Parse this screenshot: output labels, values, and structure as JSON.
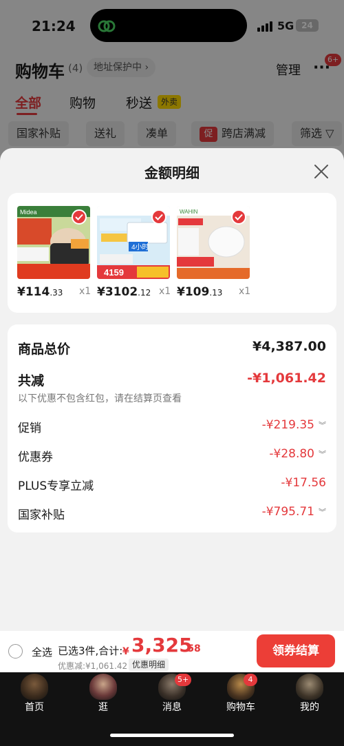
{
  "status_bar": {
    "time": "21:24",
    "network": "5G",
    "battery": "24"
  },
  "cart_header": {
    "title": "购物车",
    "count": "(4)",
    "address": "地址保护中",
    "manage": "管理",
    "more_badge": "6+"
  },
  "tabs": [
    {
      "label": "全部",
      "active": true
    },
    {
      "label": "购物"
    },
    {
      "label": "秒送",
      "tag": "外卖"
    }
  ],
  "filters": [
    "国家补贴",
    "送礼",
    "凑单",
    "跨店满减",
    "筛选"
  ],
  "filter_tag": "促",
  "sheet": {
    "title": "金额明细",
    "products": [
      {
        "price_main": "¥114",
        "price_dec": ".33",
        "qty": "x1",
        "brand": "Midea"
      },
      {
        "price_main": "¥3102",
        "price_dec": ".12",
        "qty": "x1",
        "banner_price": "4159",
        "banner_hours": "4小时"
      },
      {
        "price_main": "¥109",
        "price_dec": ".13",
        "qty": "x1",
        "brand": "WAHIN"
      }
    ],
    "details": {
      "total_label": "商品总价",
      "total_value": "¥4,387.00",
      "reduce_label": "共减",
      "reduce_value": "-¥1,061.42",
      "note": "以下优惠不包含红包，请在结算页查看",
      "items": [
        {
          "label": "促销",
          "value": "-¥219.35",
          "expandable": true
        },
        {
          "label": "优惠券",
          "value": "-¥28.80",
          "expandable": true
        },
        {
          "label": "PLUS专享立减",
          "value": "-¥17.56",
          "expandable": false
        },
        {
          "label": "国家补贴",
          "value": "-¥795.71",
          "expandable": true
        }
      ]
    }
  },
  "checkout": {
    "select_all": "全选",
    "selected_info": "已选3件,合计:",
    "currency": "¥",
    "total_main": "3,325",
    "total_dec": ".58",
    "discount": "优惠减:¥1,061.42",
    "detail_btn": "优惠明细",
    "pay_btn": "领券结算"
  },
  "nav": [
    {
      "label": "首页"
    },
    {
      "label": "逛"
    },
    {
      "label": "消息",
      "badge": "5+"
    },
    {
      "label": "购物车",
      "badge": "4"
    },
    {
      "label": "我的"
    }
  ],
  "colors": {
    "accent": "#e4393c",
    "pay_button": "#ec3e37",
    "nav_bg": "#121212"
  }
}
